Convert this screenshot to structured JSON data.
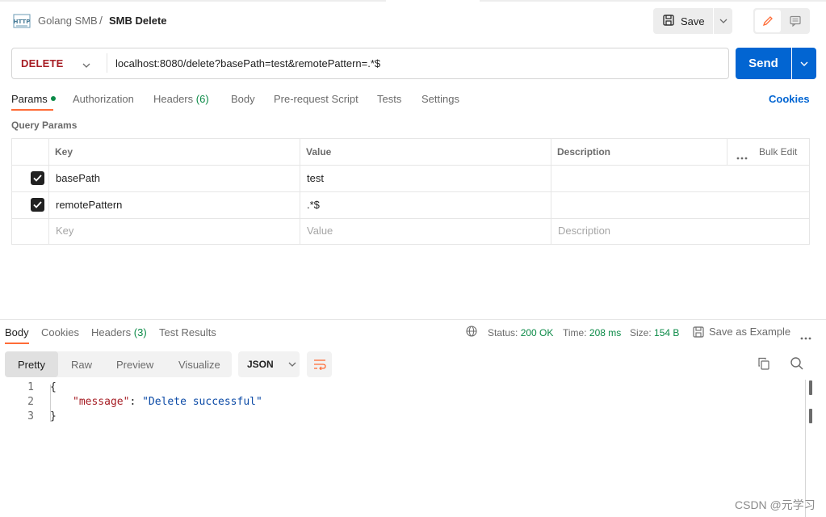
{
  "breadcrumb": {
    "parent": "Golang SMB",
    "separator": "/",
    "title": "SMB Delete"
  },
  "toolbar": {
    "save_label": "Save"
  },
  "request": {
    "method": "DELETE",
    "url": "localhost:8080/delete?basePath=test&remotePattern=.*$",
    "send_label": "Send"
  },
  "request_tabs": {
    "params": "Params",
    "authorization": "Authorization",
    "headers": "Headers",
    "headers_count": "(6)",
    "body": "Body",
    "prerequest": "Pre-request Script",
    "tests": "Tests",
    "settings": "Settings",
    "cookies": "Cookies"
  },
  "query_params": {
    "title": "Query Params",
    "columns": {
      "key": "Key",
      "value": "Value",
      "description": "Description"
    },
    "bulk_edit": "Bulk Edit",
    "rows": [
      {
        "checked": true,
        "key": "basePath",
        "value": "test",
        "description": ""
      },
      {
        "checked": true,
        "key": "remotePattern",
        "value": ".*$",
        "description": ""
      }
    ],
    "placeholder": {
      "key": "Key",
      "value": "Value",
      "description": "Description"
    }
  },
  "response_tabs": {
    "body": "Body",
    "cookies": "Cookies",
    "headers": "Headers",
    "headers_count": "(3)",
    "test_results": "Test Results"
  },
  "response_meta": {
    "status_label": "Status:",
    "status_value": "200 OK",
    "time_label": "Time:",
    "time_value": "208 ms",
    "size_label": "Size:",
    "size_value": "154 B",
    "save_example": "Save as Example"
  },
  "response_view": {
    "pretty": "Pretty",
    "raw": "Raw",
    "preview": "Preview",
    "visualize": "Visualize",
    "format": "JSON"
  },
  "response_body": {
    "lines": [
      "1",
      "2",
      "3"
    ],
    "open_brace": "{",
    "key": "\"message\"",
    "colon": ": ",
    "value": "\"Delete successful\"",
    "close_brace": "}"
  },
  "watermark": "CSDN @元学习",
  "colors": {
    "accent_orange": "#ff6c37",
    "send_blue": "#0265d2",
    "method_red": "#a61d24",
    "success_green": "#0b8a47"
  },
  "icons": [
    "http-icon",
    "save-icon",
    "chevron-down-icon",
    "pencil-icon",
    "comment-icon",
    "globe-icon",
    "more-icon",
    "wrap-icon",
    "copy-icon",
    "search-icon"
  ]
}
